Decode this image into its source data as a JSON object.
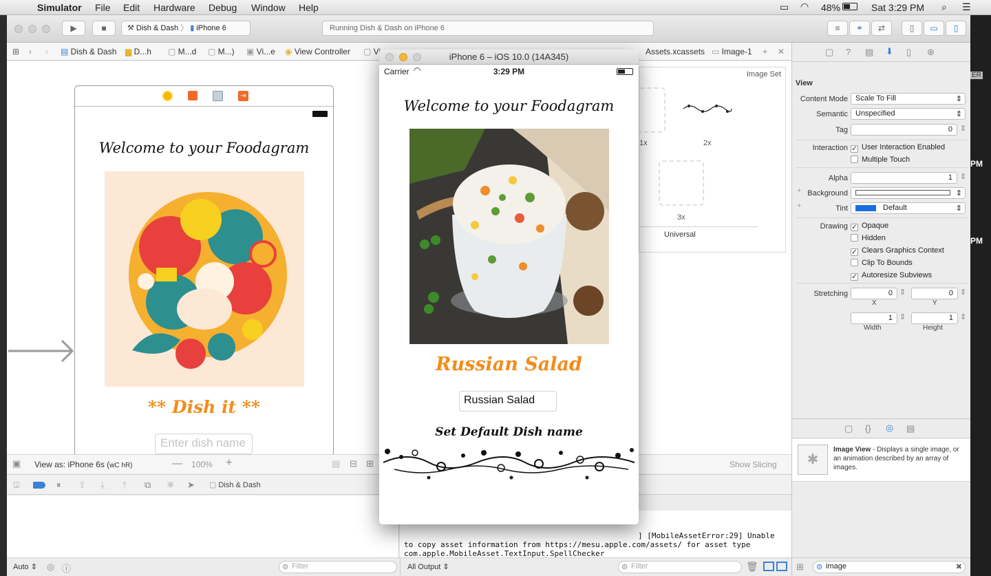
{
  "menubar": {
    "app": "Simulator",
    "items": [
      "File",
      "Edit",
      "Hardware",
      "Debug",
      "Window",
      "Help"
    ],
    "battery": "48%",
    "clock": "Sat 3:29 PM"
  },
  "toolbar": {
    "scheme": "Dish & Dash",
    "device": "iPhone 6",
    "status": "Running Dish & Dash on iPhone 6"
  },
  "jumpbar": {
    "crumbs": [
      "Dish & Dash",
      "D...h",
      "M...d",
      "M...)",
      "Vi...e",
      "View Controller",
      "Vi"
    ],
    "assets_crumbs": [
      "Assets.xcassets",
      "Image-1"
    ]
  },
  "storyboard": {
    "welcome": "Welcome to your Foodagram",
    "dish_it": "** Dish it **",
    "placeholder": "Enter dish name",
    "view_as": "View as: iPhone 6s (",
    "size_class": "wC hR)",
    "zoom": "100%"
  },
  "asset_catalog": {
    "image_set_label": "Image Set",
    "slot_1x": "1x",
    "slot_2x": "2x",
    "slot_3x": "3x",
    "universal": "Universal",
    "show_slicing": "Show Slicing"
  },
  "simulator": {
    "title": "iPhone 6 – iOS 10.0 (14A345)",
    "carrier": "Carrier",
    "time": "3:29 PM",
    "welcome": "Welcome to your Foodagram",
    "dish_title": "Russian Salad",
    "textfield_value": "Russian Salad",
    "set_default": "Set Default Dish name"
  },
  "debug": {
    "scheme_label": "Dish & Dash",
    "console_lines": [
      "] [MobileAssetError:29] Unable",
      "to copy asset information from https://mesu.apple.com/assets/ for asset type",
      "com.apple.MobileAsset.TextInput.SpellChecker"
    ],
    "auto": "Auto",
    "all_output": "All Output",
    "filter": "Filter"
  },
  "inspector": {
    "section": "View",
    "content_mode_label": "Content Mode",
    "content_mode": "Scale To Fill",
    "semantic_label": "Semantic",
    "semantic": "Unspecified",
    "tag_label": "Tag",
    "tag": "0",
    "interaction_label": "Interaction",
    "user_interaction": "User Interaction Enabled",
    "multiple_touch": "Multiple Touch",
    "alpha_label": "Alpha",
    "alpha": "1",
    "background_label": "Background",
    "tint_label": "Tint",
    "tint": "Default",
    "drawing_label": "Drawing",
    "opaque": "Opaque",
    "hidden": "Hidden",
    "clears": "Clears Graphics Context",
    "clip": "Clip To Bounds",
    "autoresize": "Autoresize Subviews",
    "stretching_label": "Stretching",
    "x_value": "0",
    "y_value": "0",
    "w_value": "1",
    "h_value": "1",
    "x_label": "X",
    "y_label": "Y",
    "width_label": "Width",
    "height_label": "Height",
    "library_title": "Image View",
    "library_desc": " - Displays a single image, or an animation described by an array of images.",
    "search_value": "image",
    "pm_1": "PM",
    "pm_2": "PM",
    "er": "ER"
  },
  "colors": {
    "orange": "#f28c1a",
    "accent_blue": "#1a6fe0"
  }
}
